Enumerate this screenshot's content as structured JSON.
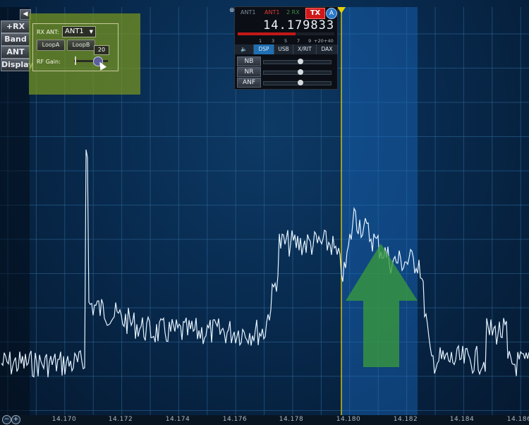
{
  "left_menu": {
    "items": [
      {
        "label": "+RX"
      },
      {
        "label": "Band"
      },
      {
        "label": "ANT"
      },
      {
        "label": "Display"
      }
    ]
  },
  "ant_panel": {
    "rx_ant_label": "RX ANT:",
    "rx_ant_value": "ANT1",
    "loop_a_label": "LoopA",
    "loop_b_label": "LoopB",
    "rf_gain_label": "RF Gain:",
    "rf_gain_value": "20"
  },
  "slice": {
    "ant_a": "ANT1",
    "ant_b": "ANT1",
    "ant_c": "2 RX",
    "tx_badge": "TX",
    "slice_letter": "A",
    "frequency": "14.179833",
    "scale_labels": [
      "1",
      "3",
      "5",
      "7",
      "9",
      "+20",
      "+40"
    ],
    "tabs": [
      "DSP",
      "USB",
      "X/RIT",
      "DAX"
    ],
    "active_tab": "DSP",
    "dsp_controls": [
      {
        "label": "NB",
        "level": 0.55
      },
      {
        "label": "NR",
        "level": 0.55
      },
      {
        "label": "ANF",
        "level": 0.55
      }
    ]
  },
  "axis": {
    "freq_labels": [
      "14.170",
      "14.172",
      "14.174",
      "14.176",
      "14.178",
      "14.180",
      "14.182",
      "14.184",
      "14.186"
    ]
  },
  "colors": {
    "background": "#082a4e",
    "passband": "#1a6ec8",
    "trace": "#dff0ff",
    "marker": "#e8d000",
    "arrow": "#3a9a3c",
    "ant_panel": "#7a961e",
    "tx_badge": "#d01818"
  }
}
